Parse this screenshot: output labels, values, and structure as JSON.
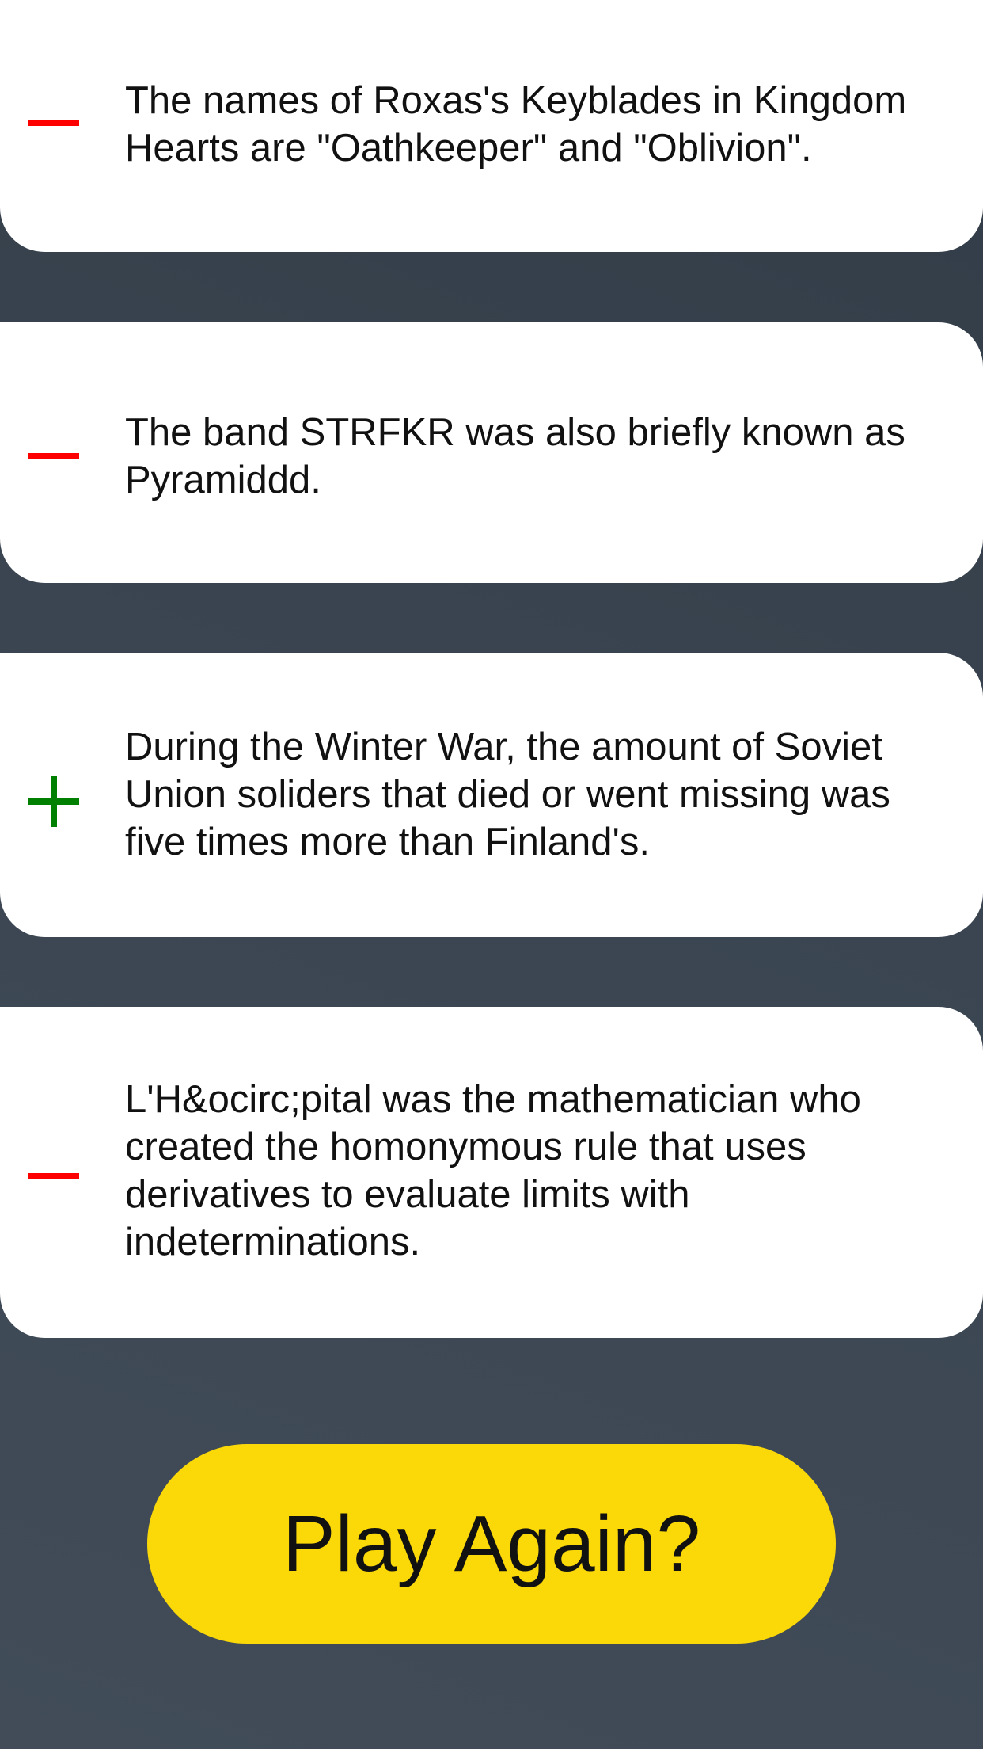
{
  "results": [
    {
      "statement": "The names of Roxas's Keyblades in Kingdom Hearts are \"Oathkeeper\" and \"Oblivion\".",
      "result": "incorrect",
      "icon": "minus-icon",
      "color": "#ff0000"
    },
    {
      "statement": "The band STRFKR was also briefly known as Pyramiddd.",
      "result": "incorrect",
      "icon": "minus-icon",
      "color": "#ff0000"
    },
    {
      "statement": "During the Winter War, the amount of Soviet Union soliders that died or went missing was five times more than Finland's.",
      "result": "correct",
      "icon": "plus-icon",
      "color": "#008000"
    },
    {
      "statement": "L'H&ocirc;pital was the mathematician who created the homonymous rule that uses derivatives to evaluate limits with indeterminations.",
      "result": "incorrect",
      "icon": "minus-icon",
      "color": "#ff0000"
    }
  ],
  "play_again": {
    "label": "Play Again?",
    "color": "#fbd808"
  },
  "background_color": "#3b4652"
}
